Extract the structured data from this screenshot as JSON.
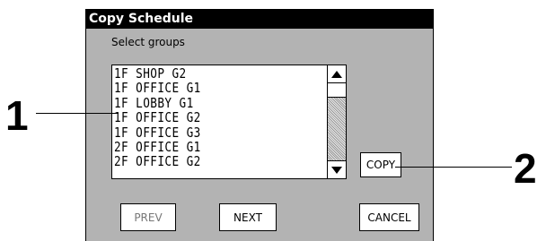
{
  "dialog": {
    "title": "Copy Schedule",
    "prompt": "Select groups",
    "groups": [
      "1F SHOP G2",
      "1F OFFICE G1",
      "1F LOBBY G1",
      "1F OFFICE G2",
      "1F OFFICE G3",
      "2F OFFICE G1",
      "2F OFFICE G2"
    ],
    "buttons": {
      "copy": "COPY",
      "prev": "PREV",
      "next": "NEXT",
      "cancel": "CANCEL"
    }
  },
  "callouts": {
    "one": "1",
    "two": "2"
  },
  "icons": {
    "scroll_up": "triangle-up-icon",
    "scroll_down": "triangle-down-icon"
  }
}
